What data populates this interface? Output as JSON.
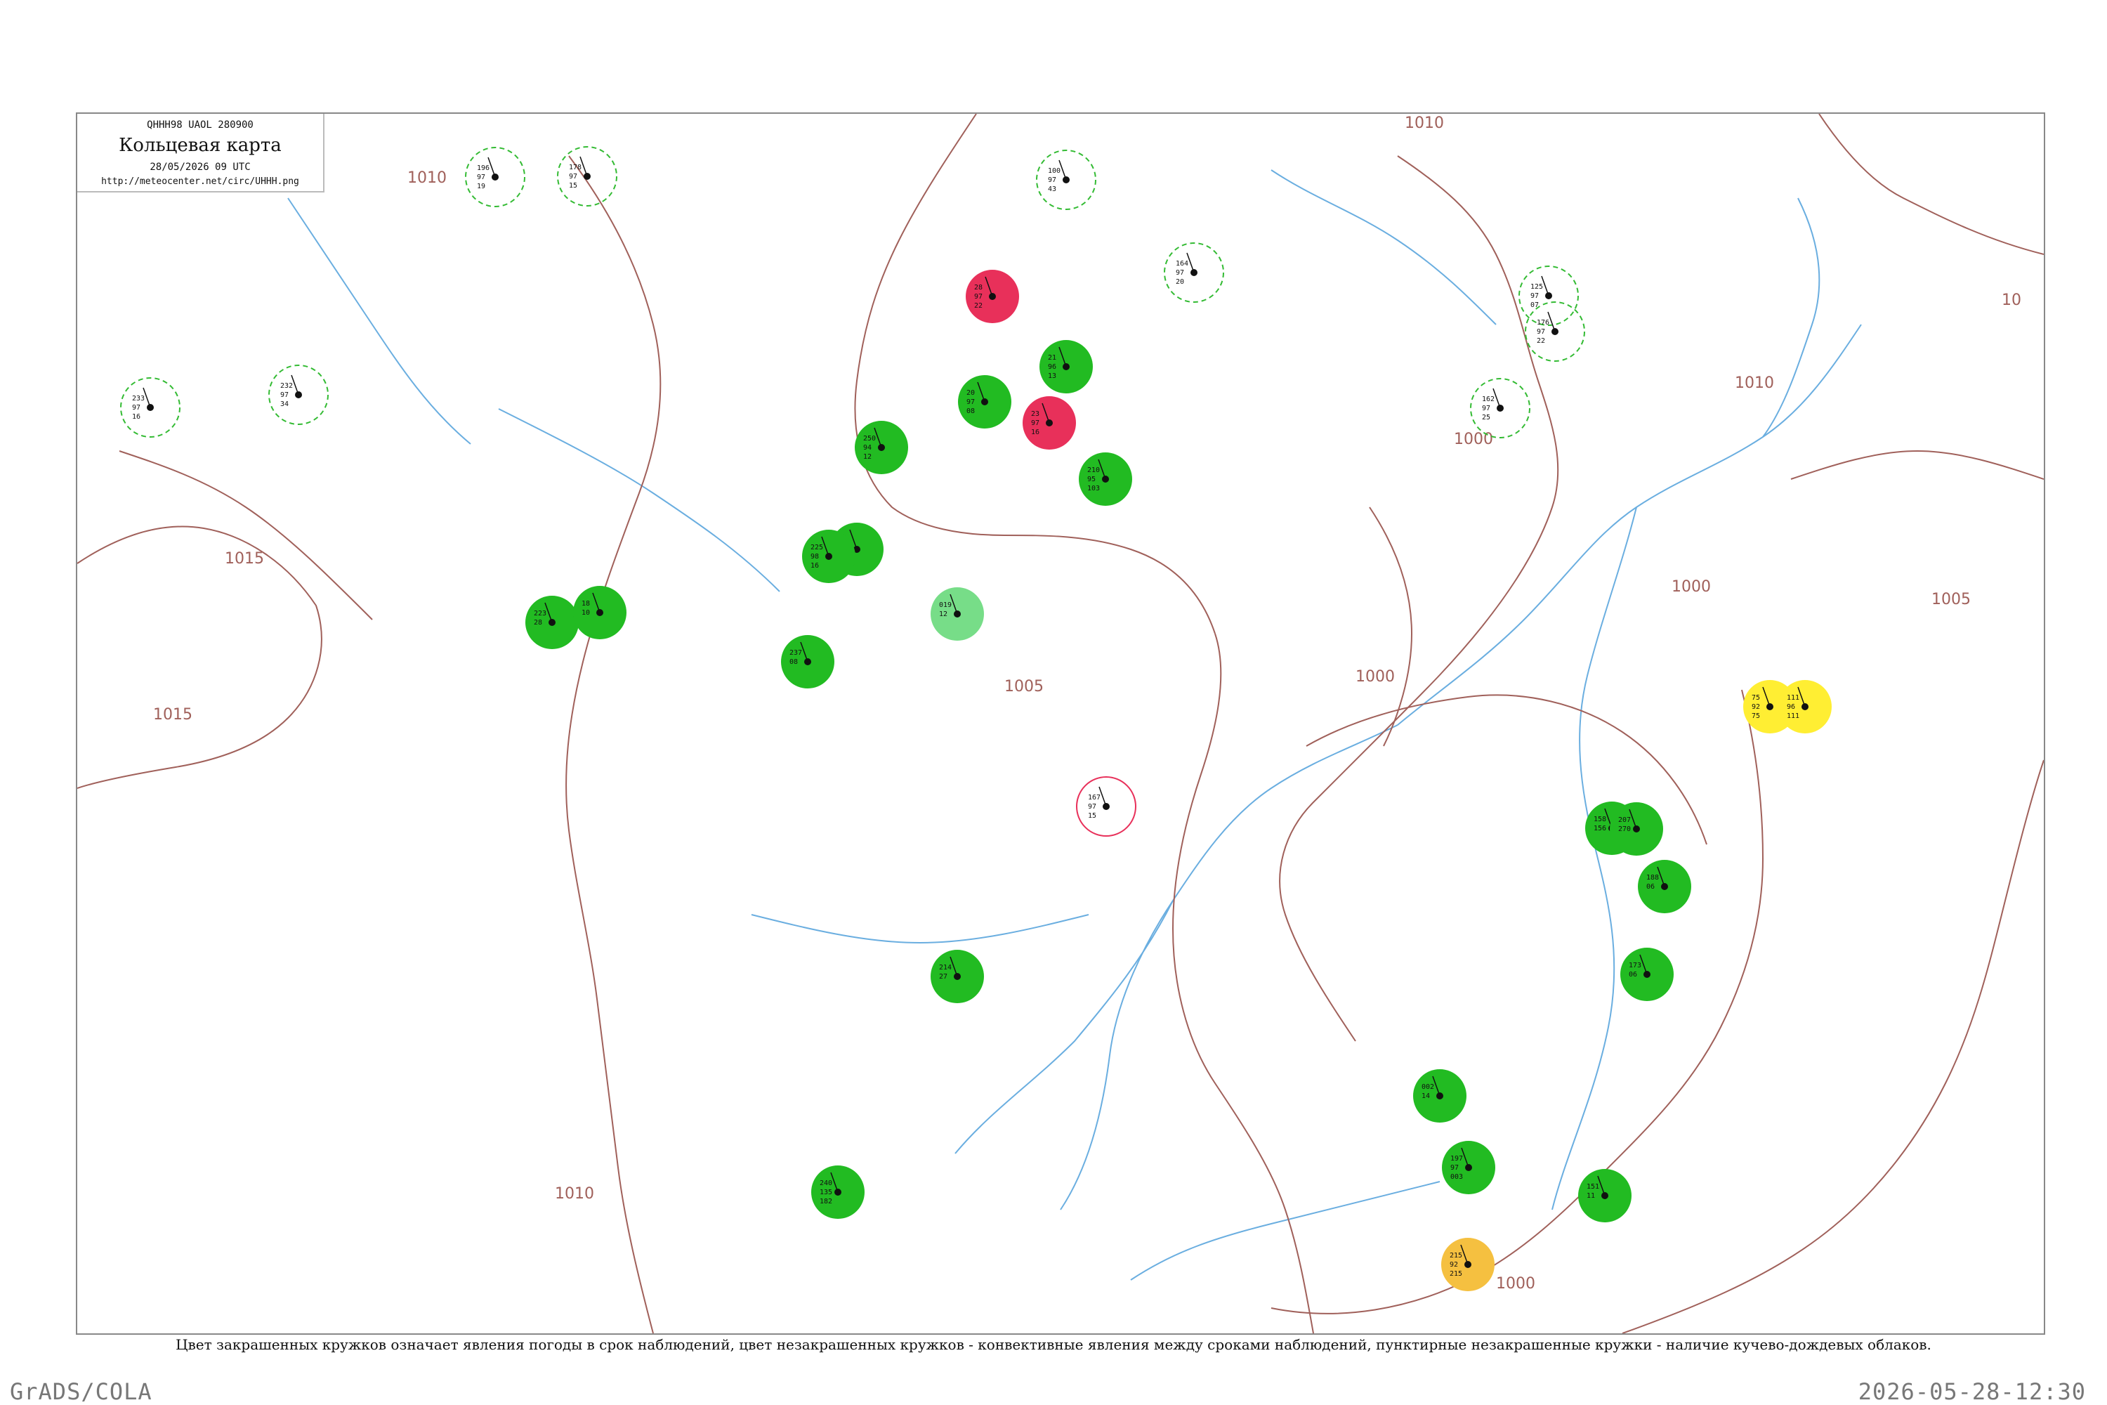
{
  "header": {
    "code": "QHHH98  UAOL  280900",
    "title": "Кольцевая карта",
    "datetime": "28/05/2026 09 UTC",
    "url": "http://meteocenter.net/circ/UHHH.png"
  },
  "caption": "Цвет закрашенных кружков означает явления погоды в срок наблюдений, цвет незакрашенных кружков - конвективные явления между сроками наблюдений, пунктирные незакрашенные кружки - наличие кучево-дождевых облаков.",
  "footer": {
    "software": "GrADS/COLA",
    "timestamp": "2026-05-28-12:30"
  },
  "colors": {
    "isobar": "#a0605a",
    "river": "#6aaee0",
    "rain": "#22bb22",
    "thunderstorm": "#e8305a",
    "shower": "#77dd88",
    "dust": "#ffee33",
    "haze": "#f5c040",
    "cb_dashed": "#33bb33",
    "convective_ring": "#e8305a"
  },
  "isobar_labels": [
    "1010",
    "1015",
    "1015",
    "1005",
    "1010",
    "1010",
    "1005",
    "1000",
    "1000",
    "1000",
    "1000",
    "1010",
    "10"
  ],
  "station_markers": [
    {
      "kind": "filled",
      "color_key": "thunderstorm",
      "values": [
        "28",
        "97",
        "22"
      ]
    },
    {
      "kind": "filled",
      "color_key": "thunderstorm",
      "values": [
        "23",
        "97",
        "16"
      ]
    },
    {
      "kind": "filled",
      "color_key": "rain",
      "values": [
        "20",
        "97",
        "08"
      ]
    },
    {
      "kind": "filled",
      "color_key": "rain",
      "values": [
        "21",
        "96",
        "13"
      ]
    },
    {
      "kind": "filled",
      "color_key": "rain",
      "values": [
        "210",
        "95",
        "103"
      ]
    },
    {
      "kind": "filled",
      "color_key": "rain",
      "values": [
        "250",
        "94",
        "12"
      ]
    },
    {
      "kind": "filled",
      "color_key": "rain",
      "values": [
        "17",
        "07"
      ]
    },
    {
      "kind": "filled",
      "color_key": "rain",
      "values": [
        "225",
        "98",
        "16"
      ]
    },
    {
      "kind": "filled",
      "color_key": "rain",
      "values": [
        "237",
        "08"
      ]
    },
    {
      "kind": "filled",
      "color_key": "rain",
      "values": [
        "240",
        "135",
        "182"
      ]
    },
    {
      "kind": "filled",
      "color_key": "rain",
      "values": [
        "214",
        "27"
      ]
    },
    {
      "kind": "filled",
      "color_key": "rain",
      "values": [
        "223",
        "28"
      ]
    },
    {
      "kind": "filled",
      "color_key": "rain",
      "values": [
        "18",
        "10"
      ]
    },
    {
      "kind": "filled",
      "color_key": "rain",
      "values": [
        "158",
        "156"
      ]
    },
    {
      "kind": "filled",
      "color_key": "rain",
      "values": [
        "207",
        "270"
      ]
    },
    {
      "kind": "filled",
      "color_key": "rain",
      "values": [
        "188",
        "06"
      ]
    },
    {
      "kind": "filled",
      "color_key": "rain",
      "values": [
        "173",
        "06"
      ]
    },
    {
      "kind": "filled",
      "color_key": "rain",
      "values": [
        "151",
        "11"
      ]
    },
    {
      "kind": "filled",
      "color_key": "rain",
      "values": [
        "002",
        "14"
      ]
    },
    {
      "kind": "filled",
      "color_key": "rain",
      "values": [
        "197",
        "97",
        "003"
      ]
    },
    {
      "kind": "filled",
      "color_key": "shower",
      "values": [
        "019",
        "12"
      ]
    },
    {
      "kind": "filled",
      "color_key": "dust",
      "values": [
        "75",
        "92",
        "75"
      ]
    },
    {
      "kind": "filled",
      "color_key": "dust",
      "values": [
        "111",
        "96",
        "111"
      ]
    },
    {
      "kind": "filled",
      "color_key": "haze",
      "values": [
        "215",
        "92",
        "215"
      ]
    },
    {
      "kind": "cb",
      "color_key": "cb_dashed",
      "values": [
        "196",
        "97",
        "19"
      ]
    },
    {
      "kind": "cb",
      "color_key": "cb_dashed",
      "values": [
        "178",
        "97",
        "15"
      ]
    },
    {
      "kind": "cb",
      "color_key": "cb_dashed",
      "values": [
        "233",
        "97",
        "16"
      ]
    },
    {
      "kind": "cb",
      "color_key": "cb_dashed",
      "values": [
        "232",
        "97",
        "34"
      ]
    },
    {
      "kind": "cb",
      "color_key": "cb_dashed",
      "values": [
        "100",
        "97",
        "43"
      ]
    },
    {
      "kind": "cb",
      "color_key": "cb_dashed",
      "values": [
        "164",
        "97",
        "20"
      ]
    },
    {
      "kind": "cb",
      "color_key": "cb_dashed",
      "values": [
        "162",
        "97",
        "25"
      ]
    },
    {
      "kind": "cb",
      "color_key": "cb_dashed",
      "values": [
        "125",
        "97",
        "07"
      ]
    },
    {
      "kind": "cb",
      "color_key": "cb_dashed",
      "values": [
        "176",
        "97",
        "22"
      ]
    },
    {
      "kind": "ring",
      "color_key": "convective_ring",
      "values": [
        "167",
        "97",
        "15"
      ]
    }
  ]
}
